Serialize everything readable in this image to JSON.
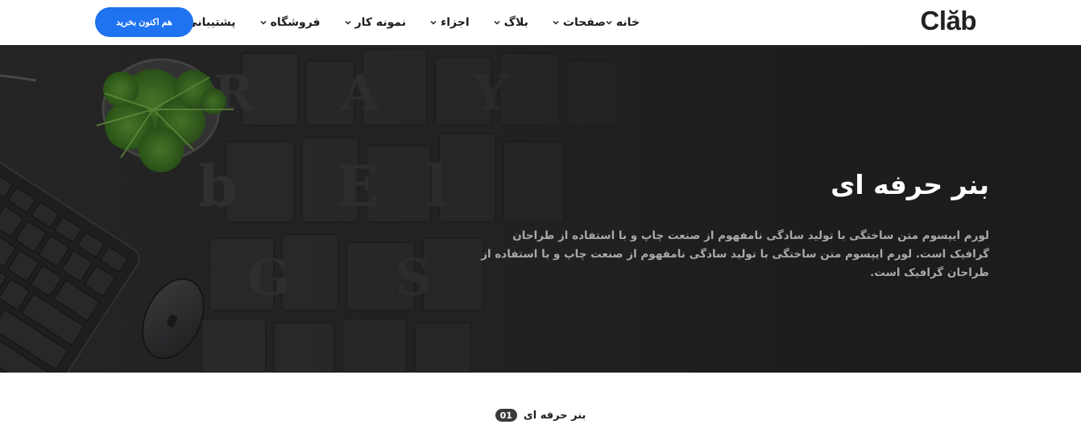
{
  "header": {
    "brand": "Clăb",
    "nav": [
      {
        "label": "خانه"
      },
      {
        "label": "صفحات"
      },
      {
        "label": "بلاگ"
      },
      {
        "label": "اجزاء"
      },
      {
        "label": "نمونه کار"
      },
      {
        "label": "فروشگاه"
      },
      {
        "label": "پشتیبانی"
      }
    ],
    "cta_label": "هم اکنون بخرید"
  },
  "hero": {
    "title": "بنر حرفه ای",
    "text": "لورم ایپسوم متن ساختگی با تولید سادگی نامفهوم از صنعت چاپ و با استفاده از طراحان گرافیک است. لورم ایپسوم متن ساختگی با تولید سادگی نامفهوم از صنعت چاپ و با استفاده از طراحان گرافیک است."
  },
  "section": {
    "label": "بنر حرفه ای",
    "number": "01"
  },
  "colors": {
    "accent": "#1f72f0",
    "hero_bg": "#262626",
    "hero_text": "#a9a9a9"
  }
}
